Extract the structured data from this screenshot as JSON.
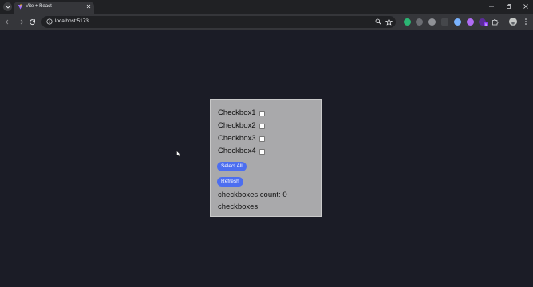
{
  "browser": {
    "tab_title": "Vite + React",
    "url": "localhost:5173",
    "badge_count": "5",
    "colors": {
      "tab_active": "#35363a",
      "tab_strip": "#202124"
    }
  },
  "app": {
    "checkboxes": [
      {
        "label": "Checkbox1",
        "checked": false
      },
      {
        "label": "Checkbox2",
        "checked": false
      },
      {
        "label": "Checkbox3",
        "checked": false
      },
      {
        "label": "Checkbox4",
        "checked": false
      }
    ],
    "select_all_label": "Select All",
    "refresh_label": "Refresh",
    "count_label": "checkboxes count:",
    "count_value": "0",
    "list_label": "checkboxes:",
    "colors": {
      "page_bg": "#1b1c26",
      "card_bg": "#a9a9ab",
      "button_bg": "#4c6ef0"
    }
  }
}
